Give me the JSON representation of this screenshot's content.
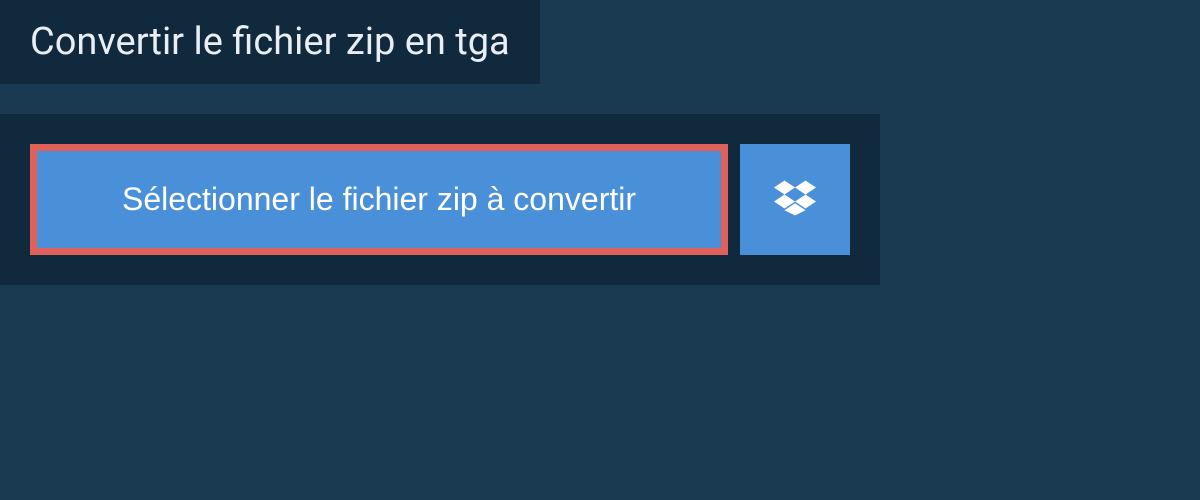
{
  "title": "Convertir le fichier zip en tga",
  "buttons": {
    "select_file": "Sélectionner le fichier zip à convertir"
  }
}
